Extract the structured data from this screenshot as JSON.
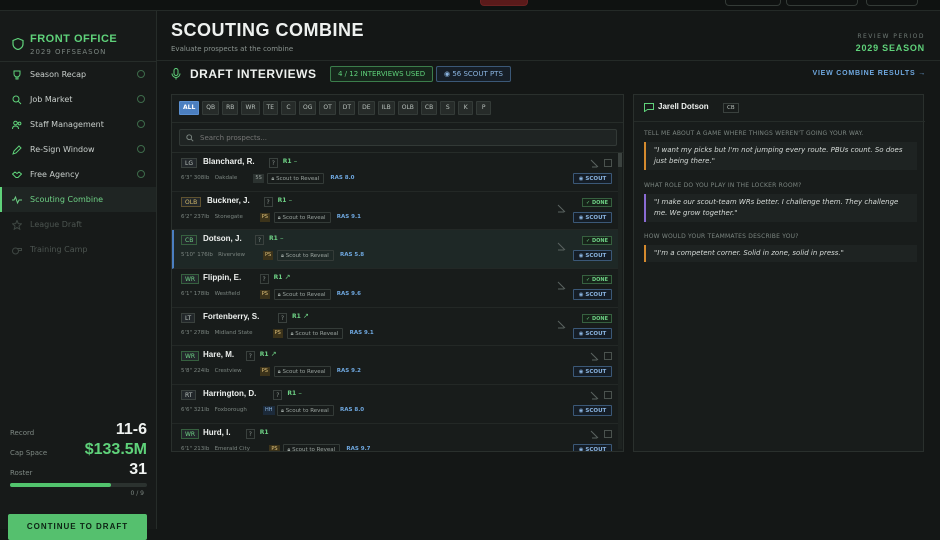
{
  "brand": {
    "title": "FRONT OFFICE",
    "subtitle": "2029 OFFSEASON"
  },
  "nav": [
    {
      "label": "Season Recap",
      "icon": "trophy-icon",
      "state": "done"
    },
    {
      "label": "Job Market",
      "icon": "search-icon",
      "state": "done"
    },
    {
      "label": "Staff Management",
      "icon": "people-icon",
      "state": "done"
    },
    {
      "label": "Re-Sign Window",
      "icon": "pen-icon",
      "state": "done"
    },
    {
      "label": "Free Agency",
      "icon": "handshake-icon",
      "state": "done"
    },
    {
      "label": "Scouting Combine",
      "icon": "pulse-icon",
      "state": "active"
    },
    {
      "label": "League Draft",
      "icon": "star-icon",
      "state": "locked"
    },
    {
      "label": "Training Camp",
      "icon": "whistle-icon",
      "state": "locked"
    }
  ],
  "stats": {
    "record_label": "Record",
    "record": "11-6",
    "cap_label": "Cap Space",
    "cap": "$133.5M",
    "roster_label": "Roster",
    "roster": "31",
    "roster_count": "0 / 9",
    "roster_fill": 0.74
  },
  "cta": "CONTINUE TO DRAFT",
  "header": {
    "title": "SCOUTING COMBINE",
    "subtitle": "Evaluate prospects at the combine",
    "review_label": "REVIEW PERIOD",
    "review_value": "2029 SEASON"
  },
  "section": {
    "title": "DRAFT INTERVIEWS",
    "interviews": "4 / 12 INTERVIEWS USED",
    "scout_pts": "56 SCOUT PTS",
    "view_link": "VIEW COMBINE RESULTS →"
  },
  "filters": [
    "ALL",
    "QB",
    "RB",
    "WR",
    "TE",
    "C",
    "OG",
    "OT",
    "DT",
    "DE",
    "ILB",
    "OLB",
    "CB",
    "S",
    "K",
    "P"
  ],
  "search_placeholder": "Search prospects...",
  "reveal_label": "Scout to Reveal",
  "scout_label": "SCOUT",
  "done_label": "DONE",
  "prospects": [
    {
      "pos": "LG",
      "posColor": "gray",
      "name": "Blanchard, R.",
      "round": "R1",
      "trend": "–",
      "meta": "6'3\" 308lb",
      "school": "Oakdale",
      "tag": "5S",
      "tagColor": "gray",
      "ras": "RAS 8.0",
      "done": false
    },
    {
      "pos": "OLB",
      "posColor": "yellow",
      "name": "Buckner, J.",
      "round": "R1",
      "trend": "–",
      "meta": "6'2\" 237lb",
      "school": "Stonegate",
      "tag": "PS",
      "tagColor": "orange",
      "ras": "RAS 9.1",
      "done": true
    },
    {
      "pos": "CB",
      "posColor": "green",
      "name": "Dotson, J.",
      "round": "R1",
      "trend": "–",
      "meta": "5'10\" 176lb",
      "school": "Riverview",
      "tag": "PS",
      "tagColor": "orange",
      "ras": "RAS 5.8",
      "done": true,
      "selected": true
    },
    {
      "pos": "WR",
      "posColor": "green",
      "name": "Flippin, E.",
      "round": "R1",
      "trend": "↗",
      "meta": "6'1\" 178lb",
      "school": "Westfield",
      "tag": "PS",
      "tagColor": "orange",
      "ras": "RAS 9.6",
      "done": true
    },
    {
      "pos": "LT",
      "posColor": "gray",
      "name": "Fortenberry, S.",
      "round": "R1",
      "trend": "↗",
      "meta": "6'3\" 278lb",
      "school": "Midland State",
      "tag": "PS",
      "tagColor": "orange",
      "ras": "RAS 9.1",
      "done": true
    },
    {
      "pos": "WR",
      "posColor": "green",
      "name": "Hare, M.",
      "round": "R1",
      "trend": "↗",
      "meta": "5'8\" 224lb",
      "school": "Crestview",
      "tag": "PS",
      "tagColor": "orange",
      "ras": "RAS 9.2",
      "done": false
    },
    {
      "pos": "RT",
      "posColor": "gray",
      "name": "Harrington, D.",
      "round": "R1",
      "trend": "–",
      "meta": "6'6\" 321lb",
      "school": "Foxborough",
      "tag": "HH",
      "tagColor": "blue",
      "ras": "RAS 8.0",
      "done": false
    },
    {
      "pos": "WR",
      "posColor": "green",
      "name": "Hurd, I.",
      "round": "R1",
      "trend": "",
      "meta": "6'1\" 213lb",
      "school": "Emerald City",
      "tag": "PS",
      "tagColor": "orange",
      "ras": "RAS 9.7",
      "done": false
    }
  ],
  "detail": {
    "name": "Jarell Dotson",
    "pos": "CB",
    "qa": [
      {
        "q": "TELL ME ABOUT A GAME WHERE THINGS WEREN'T GOING YOUR WAY.",
        "a": "\"I want my picks but I'm not jumping every route. PBUs count. So does just being there.\"",
        "color": "orange"
      },
      {
        "q": "WHAT ROLE DO YOU PLAY IN THE LOCKER ROOM?",
        "a": "\"I make our scout-team WRs better. I challenge them. They challenge me. We grow together.\"",
        "color": "purple"
      },
      {
        "q": "HOW WOULD YOUR TEAMMATES DESCRIBE YOU?",
        "a": "\"I'm a competent corner. Solid in zone, solid in press.\"",
        "color": "orange"
      }
    ]
  }
}
